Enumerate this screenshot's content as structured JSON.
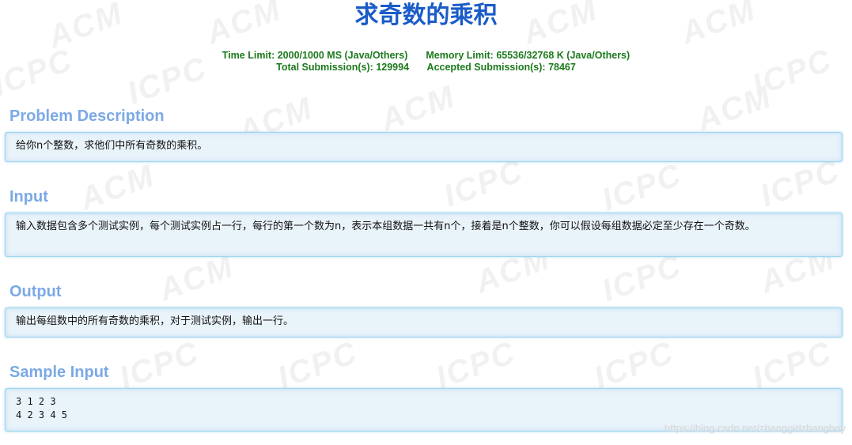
{
  "problem": {
    "title": "求奇数的乘积",
    "time_limit_label": "Time Limit:",
    "time_limit_value": "2000/1000 MS (Java/Others)",
    "memory_limit_label": "Memory Limit:",
    "memory_limit_value": "65536/32768 K (Java/Others)",
    "total_submissions_label": "Total Submission(s):",
    "total_submissions_value": "129994",
    "accepted_submissions_label": "Accepted Submission(s):",
    "accepted_submissions_value": "78467"
  },
  "sections": {
    "description": {
      "heading": "Problem Description",
      "body": "给你n个整数，求他们中所有奇数的乘积。"
    },
    "input": {
      "heading": "Input",
      "body": "输入数据包含多个测试实例，每个测试实例占一行，每行的第一个数为n，表示本组数据一共有n个，接着是n个整数，你可以假设每组数据必定至少存在一个奇数。"
    },
    "output": {
      "heading": "Output",
      "body": "输出每组数中的所有奇数的乘积，对于测试实例，输出一行。"
    },
    "sample_input": {
      "heading": "Sample Input",
      "lines": [
        "3 1 2 3",
        "4 2 3 4 5"
      ]
    }
  },
  "watermark": {
    "tiles": [
      "ACM",
      "ICPC"
    ],
    "footer": "https://blog.csdn.net/zhanggirlzhangboy"
  },
  "colors": {
    "title": "#1a5cc8",
    "limits": "#1b7a1b",
    "section_heading": "#7ca9e6",
    "panel_bg": "#e9f3fa",
    "panel_border": "#9fd7f0"
  }
}
